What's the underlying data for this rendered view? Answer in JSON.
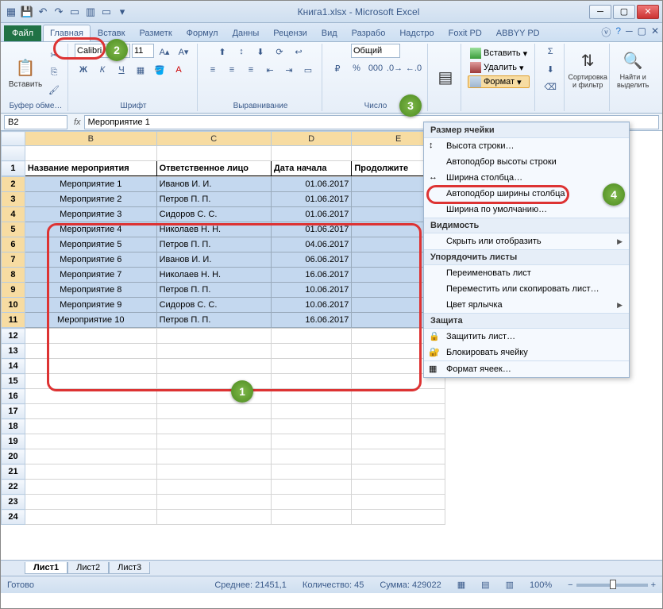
{
  "window": {
    "title": "Книга1.xlsx - Microsoft Excel"
  },
  "tabs": {
    "file": "Файл",
    "list": [
      "Главная",
      "Вставк",
      "Разметк",
      "Формул",
      "Данны",
      "Рецензи",
      "Вид",
      "Разрабо",
      "Надстро",
      "Foxit PD",
      "ABBYY PD"
    ]
  },
  "ribbon": {
    "paste": "Вставить",
    "group_clipboard": "Буфер обме…",
    "font": {
      "name": "Calibri",
      "size": "11",
      "group": "Шрифт"
    },
    "alignment": {
      "group": "Выравнивание"
    },
    "number": {
      "format": "Общий",
      "group": "Число"
    },
    "cells": {
      "insert": "Вставить",
      "delete": "Удалить",
      "format": "Формат"
    },
    "sort": "Сортировка и фильтр",
    "find": "Найти и выделить"
  },
  "formula_bar": {
    "name_box": "B2",
    "fx": "fx",
    "formula": "Мероприятие 1"
  },
  "columns": [
    "",
    "B",
    "C",
    "D",
    "E"
  ],
  "headers": {
    "b": "Название мероприятия",
    "c": "Ответственное лицо",
    "d": "Дата начала",
    "e": "Продолжите"
  },
  "chart_data": {
    "type": "table",
    "columns": [
      "Название мероприятия",
      "Ответственное лицо",
      "Дата начала"
    ],
    "rows": [
      [
        "Мероприятие 1",
        "Иванов И. И.",
        "01.06.2017"
      ],
      [
        "Мероприятие 2",
        "Петров П. П.",
        "01.06.2017"
      ],
      [
        "Мероприятие 3",
        "Сидоров С. С.",
        "01.06.2017"
      ],
      [
        "Мероприятие 4",
        "Николаев Н. Н.",
        "01.06.2017"
      ],
      [
        "Мероприятие 5",
        "Петров П. П.",
        "04.06.2017"
      ],
      [
        "Мероприятие 6",
        "Иванов И. И.",
        "06.06.2017"
      ],
      [
        "Мероприятие 7",
        "Николаев Н. Н.",
        "16.06.2017"
      ],
      [
        "Мероприятие 8",
        "Петров П. П.",
        "10.06.2017"
      ],
      [
        "Мероприятие 9",
        "Сидоров С. С.",
        "10.06.2017"
      ],
      [
        "Мероприятие 10",
        "Петров П. П.",
        "16.06.2017"
      ]
    ]
  },
  "dropdown": {
    "section_size": "Размер ячейки",
    "row_height": "Высота строки…",
    "autofit_row": "Автоподбор высоты строки",
    "col_width": "Ширина столбца…",
    "autofit_col": "Автоподбор ширины столбца",
    "default_width": "Ширина по умолчанию…",
    "section_visibility": "Видимость",
    "hide_show": "Скрыть или отобразить",
    "section_sheets": "Упорядочить листы",
    "rename": "Переименовать лист",
    "move_copy": "Переместить или скопировать лист…",
    "tab_color": "Цвет ярлычка",
    "section_protect": "Защита",
    "protect_sheet": "Защитить лист…",
    "lock_cell": "Блокировать ячейку",
    "format_cells": "Формат ячеек…"
  },
  "sheets": {
    "s1": "Лист1",
    "s2": "Лист2",
    "s3": "Лист3"
  },
  "status": {
    "ready": "Готово",
    "avg_label": "Среднее:",
    "avg_val": "21451,1",
    "count_label": "Количество:",
    "count_val": "45",
    "sum_label": "Сумма:",
    "sum_val": "429022",
    "zoom": "100%"
  },
  "callouts": {
    "c1": "1",
    "c2": "2",
    "c3": "3",
    "c4": "4"
  }
}
